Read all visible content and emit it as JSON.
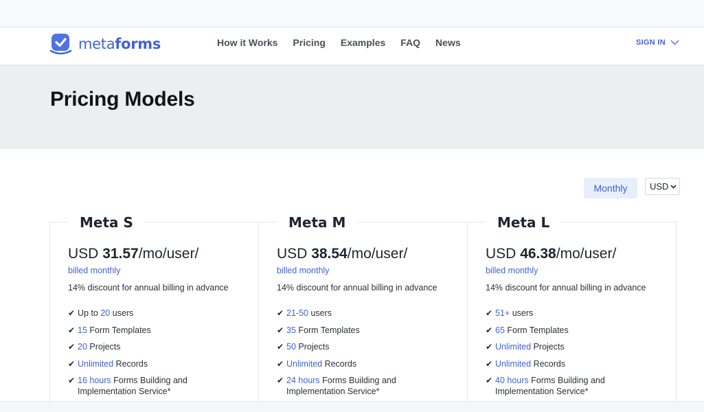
{
  "nav": {
    "logo_prefix": "meta",
    "logo_suffix": "forms",
    "links": [
      "How it Works",
      "Pricing",
      "Examples",
      "FAQ",
      "News"
    ],
    "sign_in": "SIGN IN"
  },
  "hero": {
    "title": "Pricing Models"
  },
  "billing": {
    "period_label": "Monthly",
    "currency": "USD"
  },
  "plans": [
    {
      "name": "Meta S",
      "currency": "USD",
      "price": "31.57",
      "unit": "/mo/user/",
      "billed": "billed monthly",
      "discount": "14% discount for annual billing in advance",
      "features": [
        {
          "pre": "Up to ",
          "hl": "20",
          "post": " users"
        },
        {
          "pre": "",
          "hl": "15",
          "post": " Form Templates"
        },
        {
          "pre": "",
          "hl": "20",
          "post": " Projects"
        },
        {
          "pre": "",
          "hl": "Unlimited",
          "post": " Records"
        },
        {
          "pre": "",
          "hl": "16 hours",
          "post": " Forms Building and Implementation Service*"
        }
      ]
    },
    {
      "name": "Meta M",
      "currency": "USD",
      "price": "38.54",
      "unit": "/mo/user/",
      "billed": "billed monthly",
      "discount": "14% discount for annual billing in advance",
      "features": [
        {
          "pre": "",
          "hl": "21-50",
          "post": " users"
        },
        {
          "pre": "",
          "hl": "35",
          "post": " Form Templates"
        },
        {
          "pre": "",
          "hl": "50",
          "post": " Projects"
        },
        {
          "pre": "",
          "hl": "Unlimited",
          "post": " Records"
        },
        {
          "pre": "",
          "hl": "24 hours",
          "post": " Forms Building and Implementation Service*"
        }
      ]
    },
    {
      "name": "Meta L",
      "currency": "USD",
      "price": "46.38",
      "unit": "/mo/user/",
      "billed": "billed monthly",
      "discount": "14% discount for annual billing in advance",
      "features": [
        {
          "pre": "",
          "hl": "51+",
          "post": " users"
        },
        {
          "pre": "",
          "hl": "65",
          "post": " Form Templates"
        },
        {
          "pre": "",
          "hl": "Unlimited",
          "post": " Projects"
        },
        {
          "pre": "",
          "hl": "Unlimited",
          "post": " Records"
        },
        {
          "pre": "",
          "hl": "40 hours",
          "post": " Forms Building and Implementation Service*"
        }
      ]
    }
  ],
  "colors": {
    "accent": "#3f63d3",
    "hero_bg": "#edeef0",
    "monthly_bg": "#e7effb",
    "text": "#1f2430"
  },
  "icons": {
    "logo": "check-badge-icon",
    "sign_in": "chevron-down-icon",
    "currency": "chevron-down-icon",
    "feature": "checkmark-icon"
  }
}
